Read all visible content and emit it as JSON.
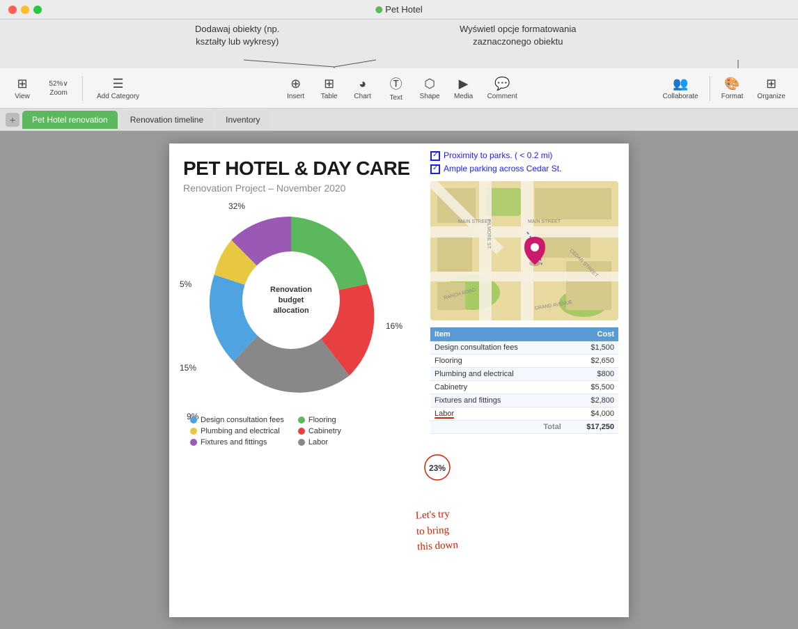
{
  "window": {
    "title": "Pet Hotel",
    "traffic_lights": [
      "close",
      "minimize",
      "maximize"
    ]
  },
  "annotations": {
    "left_callout": "Dodawaj obiekty (np.\nkształty lub wykresy)",
    "right_callout": "Wyświetl opcje formatowania\nzaznaczonego obiektu"
  },
  "toolbar": {
    "view_label": "View",
    "zoom_label": "52%",
    "add_category_label": "Add Category",
    "insert_label": "Insert",
    "table_label": "Table",
    "chart_label": "Chart",
    "text_label": "Text",
    "shape_label": "Shape",
    "media_label": "Media",
    "comment_label": "Comment",
    "collaborate_label": "Collaborate",
    "format_label": "Format",
    "organize_label": "Organize"
  },
  "tabs": {
    "add_label": "+",
    "items": [
      {
        "label": "Pet Hotel renovation",
        "active": true
      },
      {
        "label": "Renovation timeline",
        "active": false
      },
      {
        "label": "Inventory",
        "active": false
      }
    ]
  },
  "slide": {
    "title": "PET HOTEL & DAY CARE",
    "subtitle": "Renovation Project – November 2020",
    "checklist": [
      {
        "text": "Proximity to parks. ( < 0.2 mi)",
        "checked": true
      },
      {
        "text": "Ample parking across  Cedar St.",
        "checked": true
      }
    ],
    "chart": {
      "center_text": "Renovation budget allocation",
      "segments": [
        {
          "label": "Design consultation fees",
          "color": "#4fa3e0",
          "pct": 9
        },
        {
          "label": "Plumbing and electrical",
          "color": "#e8c840",
          "pct": 5
        },
        {
          "label": "Fixtures and fittings",
          "color": "#9b59b6",
          "pct": 16
        },
        {
          "label": "Flooring",
          "color": "#5cb85c",
          "pct": 32
        },
        {
          "label": "Cabinetry",
          "color": "#e84040",
          "pct": 15
        },
        {
          "label": "Labor",
          "color": "#888888",
          "pct": 23
        }
      ],
      "percentages": {
        "top": "32%",
        "right": "16%",
        "left_top": "5%",
        "left_mid": "15%",
        "left_bot": "9%",
        "bot_right": "23%"
      }
    },
    "table": {
      "headers": [
        "Item",
        "Cost"
      ],
      "rows": [
        {
          "item": "Design consultation fees",
          "cost": "$1,500"
        },
        {
          "item": "Flooring",
          "cost": "$2,650"
        },
        {
          "item": "Plumbing and electrical",
          "cost": "$800"
        },
        {
          "item": "Cabinetry",
          "cost": "$5,500"
        },
        {
          "item": "Fixtures and fittings",
          "cost": "$2,800"
        },
        {
          "item": "Labor",
          "cost": "$4,000",
          "underline": true
        }
      ],
      "total_label": "Total",
      "total_value": "$17,250"
    },
    "handwritten_text": "Let's try\nto bring\nthis down"
  }
}
